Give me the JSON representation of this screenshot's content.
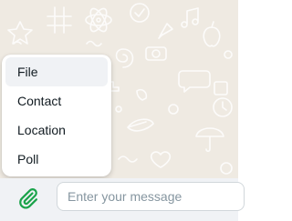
{
  "attach_menu": {
    "items": [
      {
        "label": "File"
      },
      {
        "label": "Contact"
      },
      {
        "label": "Location"
      },
      {
        "label": "Poll"
      }
    ]
  },
  "composer": {
    "placeholder": "Enter your message",
    "value": ""
  },
  "icons": {
    "attach": "paperclip-icon"
  },
  "colors": {
    "chat_background": "#efeae2",
    "attach_icon": "#1aa34a",
    "footer_background": "#f0f2f5"
  }
}
